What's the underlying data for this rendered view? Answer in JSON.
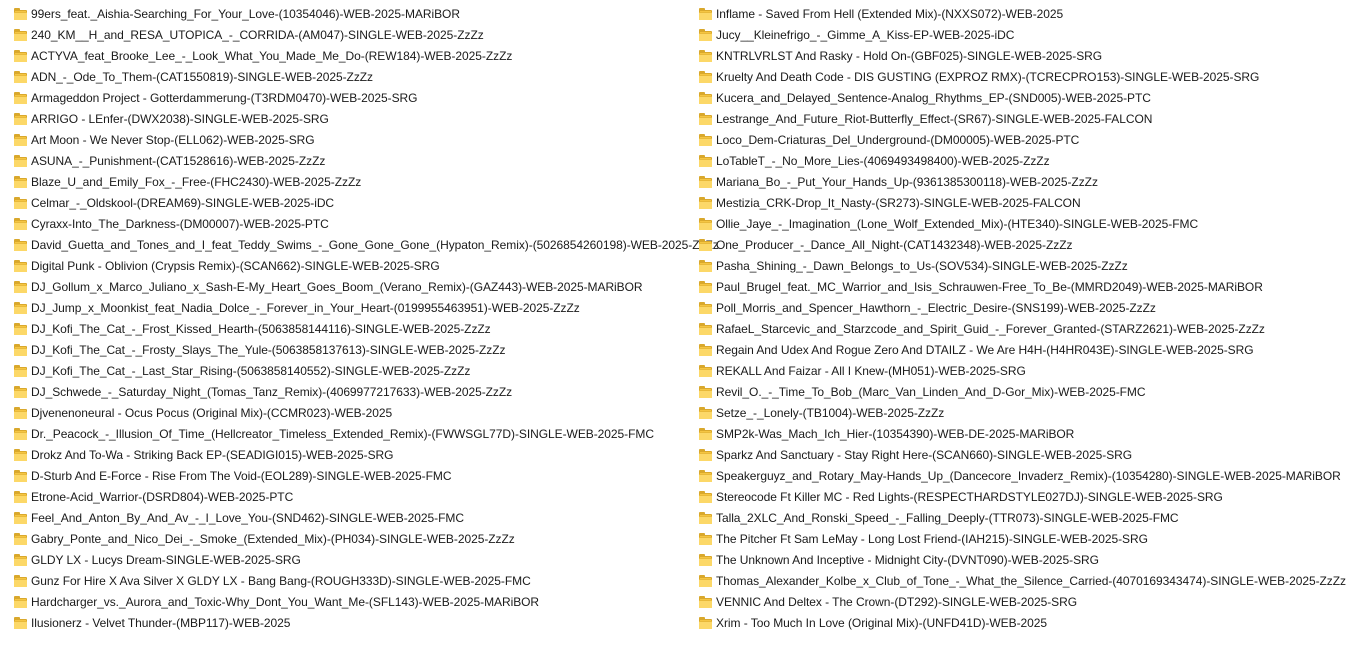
{
  "colors": {
    "folder_body": "#f5c542",
    "folder_front": "#fcd868",
    "folder_edge": "#d9a82c",
    "background": "#ffffff",
    "text": "#1a1a1a"
  },
  "icon": "folder-icon",
  "columns": [
    {
      "items": [
        "99ers_feat._Aishia-Searching_For_Your_Love-(10354046)-WEB-2025-MARiBOR",
        "240_KM__H_and_RESA_UTOPICA_-_CORRIDA-(AM047)-SINGLE-WEB-2025-ZzZz",
        "ACTYVA_feat_Brooke_Lee_-_Look_What_You_Made_Me_Do-(REW184)-WEB-2025-ZzZz",
        "ADN_-_Ode_To_Them-(CAT1550819)-SINGLE-WEB-2025-ZzZz",
        "Armageddon Project - Gotterdammerung-(T3RDM0470)-WEB-2025-SRG",
        "ARRIGO - LEnfer-(DWX2038)-SINGLE-WEB-2025-SRG",
        "Art Moon - We Never Stop-(ELL062)-WEB-2025-SRG",
        "ASUNA_-_Punishment-(CAT1528616)-WEB-2025-ZzZz",
        "Blaze_U_and_Emily_Fox_-_Free-(FHC2430)-WEB-2025-ZzZz",
        "Celmar_-_Oldskool-(DREAM69)-SINGLE-WEB-2025-iDC",
        "Cyraxx-Into_The_Darkness-(DM00007)-WEB-2025-PTC",
        "David_Guetta_and_Tones_and_I_feat_Teddy_Swims_-_Gone_Gone_Gone_(Hypaton_Remix)-(5026854260198)-WEB-2025-ZzZz",
        "Digital Punk - Oblivion (Crypsis Remix)-(SCAN662)-SINGLE-WEB-2025-SRG",
        "DJ_Gollum_x_Marco_Juliano_x_Sash-E-My_Heart_Goes_Boom_(Verano_Remix)-(GAZ443)-WEB-2025-MARiBOR",
        "DJ_Jump_x_Moonkist_feat_Nadia_Dolce_-_Forever_in_Your_Heart-(0199955463951)-WEB-2025-ZzZz",
        "DJ_Kofi_The_Cat_-_Frost_Kissed_Hearth-(5063858144116)-SINGLE-WEB-2025-ZzZz",
        "DJ_Kofi_The_Cat_-_Frosty_Slays_The_Yule-(5063858137613)-SINGLE-WEB-2025-ZzZz",
        "DJ_Kofi_The_Cat_-_Last_Star_Rising-(5063858140552)-SINGLE-WEB-2025-ZzZz",
        "DJ_Schwede_-_Saturday_Night_(Tomas_Tanz_Remix)-(4069977217633)-WEB-2025-ZzZz",
        "Djvenenoneural - Ocus Pocus (Original Mix)-(CCMR023)-WEB-2025",
        "Dr._Peacock_-_Illusion_Of_Time_(Hellcreator_Timeless_Extended_Remix)-(FWWSGL77D)-SINGLE-WEB-2025-FMC",
        "Drokz And To-Wa - Striking Back EP-(SEADIGI015)-WEB-2025-SRG",
        "D-Sturb And E-Force - Rise From The Void-(EOL289)-SINGLE-WEB-2025-FMC",
        "Etrone-Acid_Warrior-(DSRD804)-WEB-2025-PTC",
        "Feel_And_Anton_By_And_Av_-_I_Love_You-(SND462)-SINGLE-WEB-2025-FMC",
        "Gabry_Ponte_and_Nico_Dei_-_Smoke_(Extended_Mix)-(PH034)-SINGLE-WEB-2025-ZzZz",
        "GLDY LX - Lucys Dream-SINGLE-WEB-2025-SRG",
        "Gunz For Hire X Ava Silver X GLDY LX - Bang Bang-(ROUGH333D)-SINGLE-WEB-2025-FMC",
        "Hardcharger_vs._Aurora_and_Toxic-Why_Dont_You_Want_Me-(SFL143)-WEB-2025-MARiBOR",
        "Ilusionerz - Velvet Thunder-(MBP117)-WEB-2025"
      ]
    },
    {
      "items": [
        "Inflame - Saved From Hell (Extended Mix)-(NXXS072)-WEB-2025",
        "Jucy__Kleinefrigo_-_Gimme_A_Kiss-EP-WEB-2025-iDC",
        "KNTRLVRLST And Rasky - Hold On-(GBF025)-SINGLE-WEB-2025-SRG",
        "Kruelty And Death Code - DIS GUSTING (EXPROZ RMX)-(TCRECPRO153)-SINGLE-WEB-2025-SRG",
        "Kucera_and_Delayed_Sentence-Analog_Rhythms_EP-(SND005)-WEB-2025-PTC",
        "Lestrange_And_Future_Riot-Butterfly_Effect-(SR67)-SINGLE-WEB-2025-FALCON",
        "Loco_Dem-Criaturas_Del_Underground-(DM00005)-WEB-2025-PTC",
        "LoTableT_-_No_More_Lies-(4069493498400)-WEB-2025-ZzZz",
        "Mariana_Bo_-_Put_Your_Hands_Up-(9361385300118)-WEB-2025-ZzZz",
        "Mestizia_CRK-Drop_It_Nasty-(SR273)-SINGLE-WEB-2025-FALCON",
        "Ollie_Jaye_-_Imagination_(Lone_Wolf_Extended_Mix)-(HTE340)-SINGLE-WEB-2025-FMC",
        "One_Producer_-_Dance_All_Night-(CAT1432348)-WEB-2025-ZzZz",
        "Pasha_Shining_-_Dawn_Belongs_to_Us-(SOV534)-SINGLE-WEB-2025-ZzZz",
        "Paul_Brugel_feat._MC_Warrior_and_Isis_Schrauwen-Free_To_Be-(MMRD2049)-WEB-2025-MARiBOR",
        "Poll_Morris_and_Spencer_Hawthorn_-_Electric_Desire-(SNS199)-WEB-2025-ZzZz",
        "RafaeL_Starcevic_and_Starzcode_and_Spirit_Guid_-_Forever_Granted-(STARZ2621)-WEB-2025-ZzZz",
        "Regain And Udex And Rogue Zero And DTAILZ - We Are H4H-(H4HR043E)-SINGLE-WEB-2025-SRG",
        "REKALL And Faizar - All I Knew-(MH051)-WEB-2025-SRG",
        "Revil_O._-_Time_To_Bob_(Marc_Van_Linden_And_D-Gor_Mix)-WEB-2025-FMC",
        "Setze_-_Lonely-(TB1004)-WEB-2025-ZzZz",
        "SMP2k-Was_Mach_Ich_Hier-(10354390)-WEB-DE-2025-MARiBOR",
        "Sparkz And Sanctuary - Stay Right Here-(SCAN660)-SINGLE-WEB-2025-SRG",
        "Speakerguyz_and_Rotary_May-Hands_Up_(Dancecore_Invaderz_Remix)-(10354280)-SINGLE-WEB-2025-MARiBOR",
        "Stereocode Ft Killer MC - Red Lights-(RESPECTHARDSTYLE027DJ)-SINGLE-WEB-2025-SRG",
        "Talla_2XLC_And_Ronski_Speed_-_Falling_Deeply-(TTR073)-SINGLE-WEB-2025-FMC",
        "The Pitcher Ft Sam LeMay - Long Lost Friend-(IAH215)-SINGLE-WEB-2025-SRG",
        "The Unknown And Inceptive - Midnight City-(DVNT090)-WEB-2025-SRG",
        "Thomas_Alexander_Kolbe_x_Club_of_Tone_-_What_the_Silence_Carried-(4070169343474)-SINGLE-WEB-2025-ZzZz",
        "VENNIC And Deltex - The Crown-(DT292)-SINGLE-WEB-2025-SRG",
        "Xrim - Too Much In Love (Original Mix)-(UNFD41D)-WEB-2025"
      ]
    }
  ]
}
